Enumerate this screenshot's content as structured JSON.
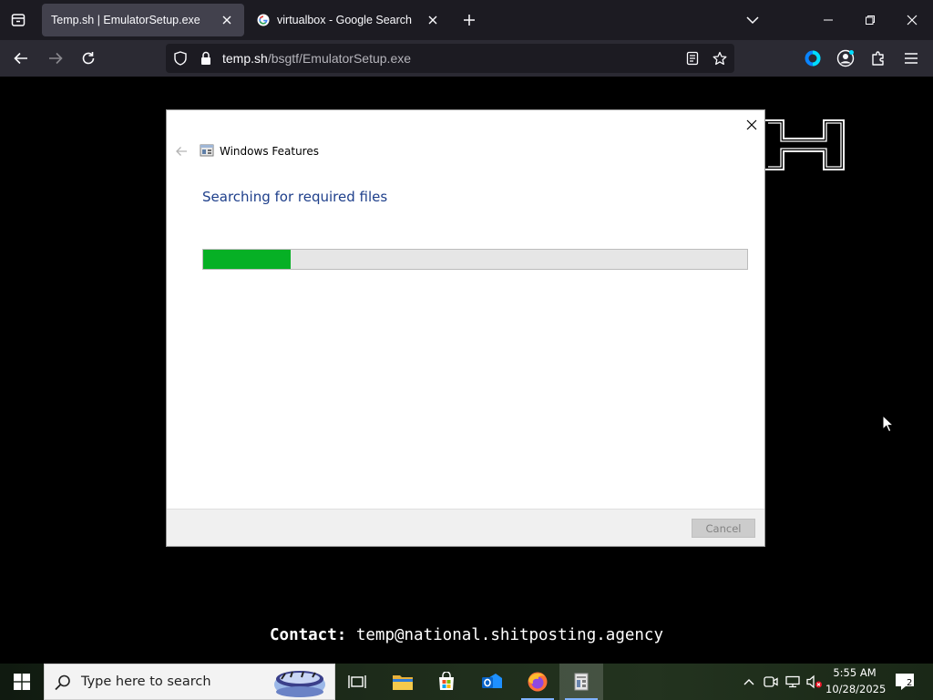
{
  "browser": {
    "tabs": [
      {
        "title": "Temp.sh | EmulatorSetup.exe",
        "active": true
      },
      {
        "title": "virtualbox - Google Search",
        "active": false
      }
    ],
    "url": {
      "host": "temp.sh",
      "path": "/bsgtf/EmulatorSetup.exe"
    },
    "icons": [
      "tab-list-icon",
      "new-tab-icon",
      "list-all-tabs-icon",
      "minimize-icon",
      "maximize-icon",
      "close-icon",
      "back-icon",
      "forward-icon",
      "reload-icon",
      "shield-icon",
      "lock-icon",
      "reader-view-icon",
      "bookmark-star-icon",
      "vpn-icon",
      "account-icon",
      "extensions-icon",
      "menu-icon"
    ]
  },
  "page": {
    "contact_label": "Contact:",
    "contact_email": "temp@national.shitposting.agency"
  },
  "dialog": {
    "title": "Windows Features",
    "heading": "Searching for required files",
    "progress_fraction": 0.16,
    "cancel_label": "Cancel"
  },
  "taskbar": {
    "search_placeholder": "Type here to search",
    "apps": [
      "task-view",
      "file-explorer",
      "microsoft-store",
      "outlook",
      "firefox",
      "windows-features"
    ],
    "clock_time": "5:55 AM",
    "clock_date": "10/28/2025",
    "notification_count": "2"
  },
  "colors": {
    "progress_fill": "#06b025",
    "dialog_heading": "#1e3f8b",
    "browser_dark": "#1c1b22"
  }
}
